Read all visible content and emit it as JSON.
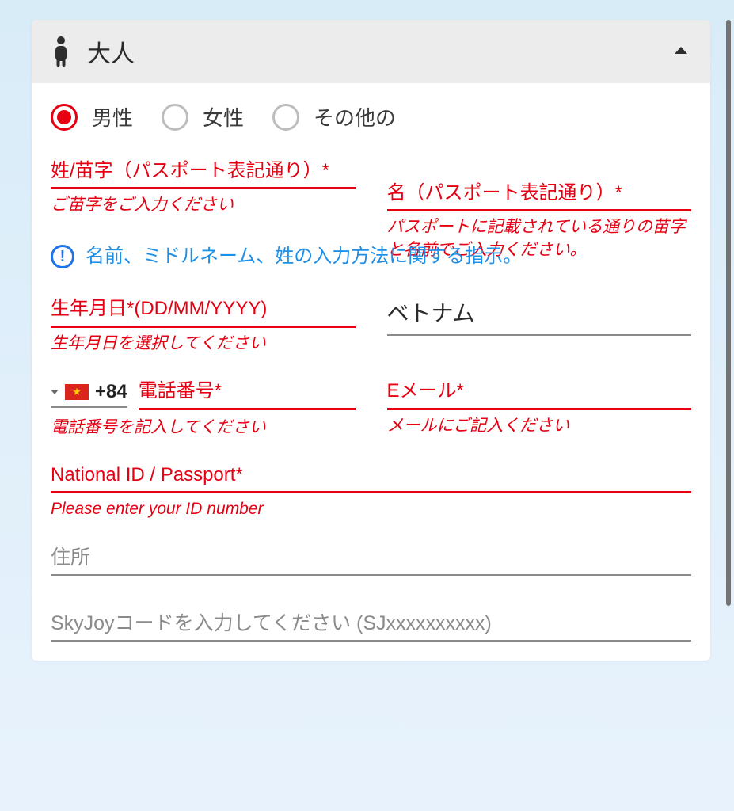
{
  "section": {
    "title": "大人"
  },
  "gender": {
    "male": "男性",
    "female": "女性",
    "other": "その他の",
    "selected": "male"
  },
  "fields": {
    "surname": {
      "label": "姓/苗字（パスポート表記通り）*",
      "hint": "ご苗字をご入力ください"
    },
    "givenname": {
      "label": "名（パスポート表記通り）*",
      "hint": "パスポートに記載されている通りの苗字と名前でご入力ください。"
    },
    "info_text": "名前、ミドルネーム、姓の入力方法に関する指示。",
    "dob": {
      "label": "生年月日*(DD/MM/YYYY)",
      "hint": "生年月日を選択してください"
    },
    "nationality": {
      "value": "ベトナム"
    },
    "phone": {
      "prefix": "+84",
      "label": "電話番号*",
      "hint": "電話番号を記入してください"
    },
    "email": {
      "label": "Eメール*",
      "hint": "メールにご記入ください"
    },
    "idpassport": {
      "label": "National ID / Passport*",
      "hint": "Please enter your ID number"
    },
    "address": {
      "placeholder": "住所"
    },
    "skyjoy": {
      "placeholder": "SkyJoyコードを入力してください (SJxxxxxxxxxx)"
    }
  }
}
